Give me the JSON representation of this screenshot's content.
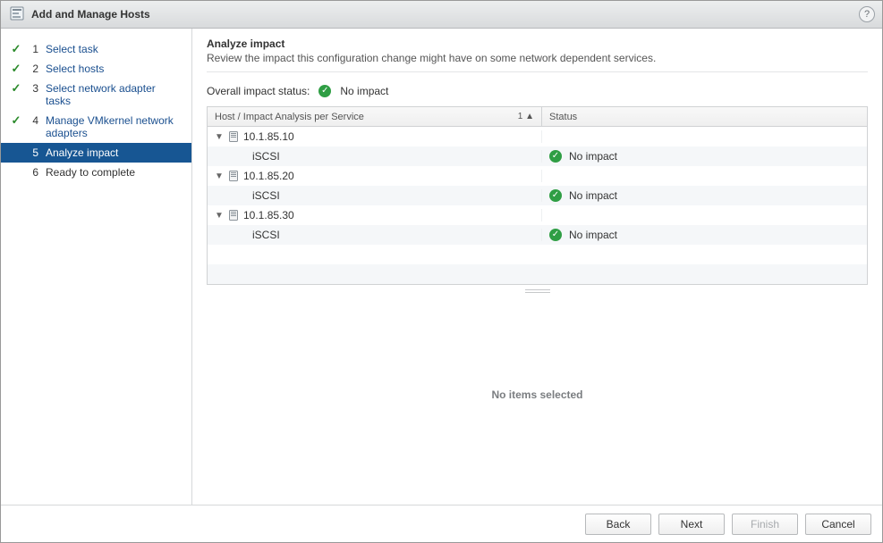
{
  "title": "Add and Manage Hosts",
  "help_tooltip": "?",
  "steps": [
    {
      "num": "1",
      "label": "Select task",
      "state": "done"
    },
    {
      "num": "2",
      "label": "Select hosts",
      "state": "done"
    },
    {
      "num": "3",
      "label": "Select network adapter tasks",
      "state": "done"
    },
    {
      "num": "4",
      "label": "Manage VMkernel network adapters",
      "state": "done"
    },
    {
      "num": "5",
      "label": "Analyze impact",
      "state": "active"
    },
    {
      "num": "6",
      "label": "Ready to complete",
      "state": "future"
    }
  ],
  "main": {
    "heading": "Analyze impact",
    "description": "Review the impact this configuration change might have on some network dependent services.",
    "overall_label": "Overall impact status:",
    "overall_value": "No impact"
  },
  "table": {
    "col_left": "Host / Impact Analysis per Service",
    "col_right": "Status",
    "sort_indicator": "1 ▲",
    "rows": [
      {
        "type": "host",
        "name": "10.1.85.10"
      },
      {
        "type": "service",
        "name": "iSCSI",
        "status": "No impact"
      },
      {
        "type": "host",
        "name": "10.1.85.20"
      },
      {
        "type": "service",
        "name": "iSCSI",
        "status": "No impact"
      },
      {
        "type": "host",
        "name": "10.1.85.30"
      },
      {
        "type": "service",
        "name": "iSCSI",
        "status": "No impact"
      }
    ]
  },
  "lower_placeholder": "No items selected",
  "buttons": {
    "back": "Back",
    "next": "Next",
    "finish": "Finish",
    "cancel": "Cancel"
  }
}
